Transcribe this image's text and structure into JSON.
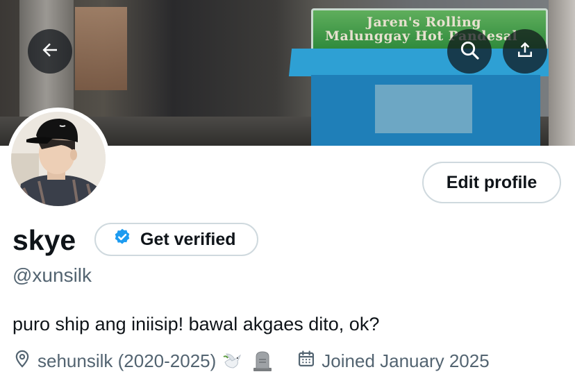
{
  "banner": {
    "sign_text_line1": "Jaren's Rolling",
    "sign_text_line2": "Malunggay Hot Pandesal"
  },
  "profile": {
    "display_name": "skye",
    "get_verified_label": "Get verified",
    "handle": "@xunsilk",
    "edit_profile_label": "Edit profile",
    "bio": "puro ship ang iniisip! bawal akgaes dito, ok?",
    "location": "sehunsilk (2020-2025)",
    "joined": "Joined January 2025"
  },
  "icons": {
    "back": "arrow-left-icon",
    "search": "search-icon",
    "share": "share-icon",
    "verified": "verified-badge-icon",
    "location": "location-pin-icon",
    "calendar": "calendar-icon",
    "dove": "dove-emoji",
    "headstone": "headstone-emoji"
  },
  "colors": {
    "accent": "#1d9bf0",
    "text_primary": "#0f1419",
    "text_secondary": "#536471",
    "border": "#cfd9de"
  }
}
